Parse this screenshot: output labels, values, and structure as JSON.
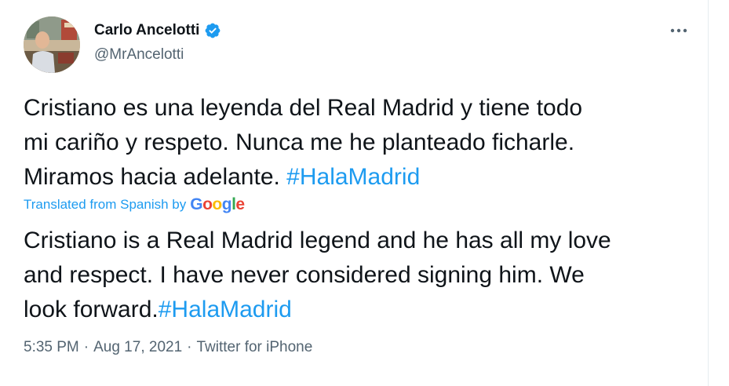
{
  "author": {
    "name": "Carlo Ancelotti",
    "handle": "@MrAncelotti",
    "verified": true
  },
  "tweet": {
    "original_text": "Cristiano es una leyenda del Real Madrid y tiene todo\nmi cariño y respeto. Nunca me he planteado ficharle.\nMiramos hacia adelante. ",
    "original_hashtag": "#HalaMadrid",
    "translation_label": "Translated from Spanish by",
    "translation_provider": "Google",
    "translated_text": "Cristiano is a Real Madrid legend and he has all my love\nand respect. I have never considered signing him. We\nlook forward.",
    "translated_hashtag": "#HalaMadrid"
  },
  "meta": {
    "time": "5:35 PM",
    "separator": "·",
    "date": "Aug 17, 2021",
    "source": "Twitter for iPhone"
  },
  "colors": {
    "link": "#1d9bf0",
    "secondary_text": "#536471",
    "primary_text": "#0f1419"
  },
  "icons": {
    "verified": "verified-badge-icon",
    "more": "more-options-icon"
  }
}
